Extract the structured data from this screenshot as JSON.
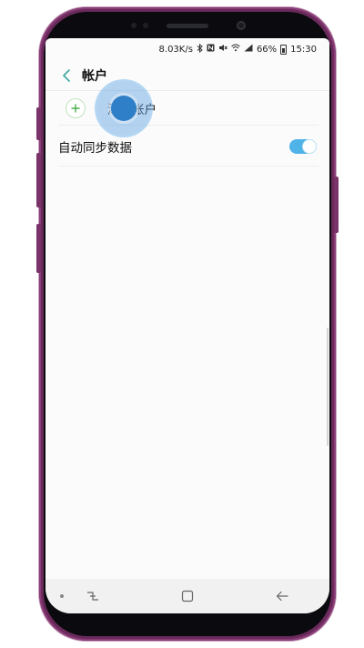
{
  "status_bar": {
    "network_speed": "8.03K/s",
    "battery_percent": "66%",
    "time": "15:30"
  },
  "header": {
    "title": "帐户"
  },
  "list": {
    "add_account_label": "添加帐户",
    "auto_sync_label": "自动同步数据",
    "auto_sync_enabled": true
  },
  "colors": {
    "accent": "#3aa99f",
    "toggle_on": "#4fb3e8",
    "touch_indicator": "#2f7fc8",
    "phone_body": "#6b2a5c"
  },
  "icons": {
    "back": "back-chevron-icon",
    "add": "plus-circle-icon",
    "recents": "recents-icon",
    "home": "home-icon",
    "back_nav": "back-arrow-icon"
  }
}
